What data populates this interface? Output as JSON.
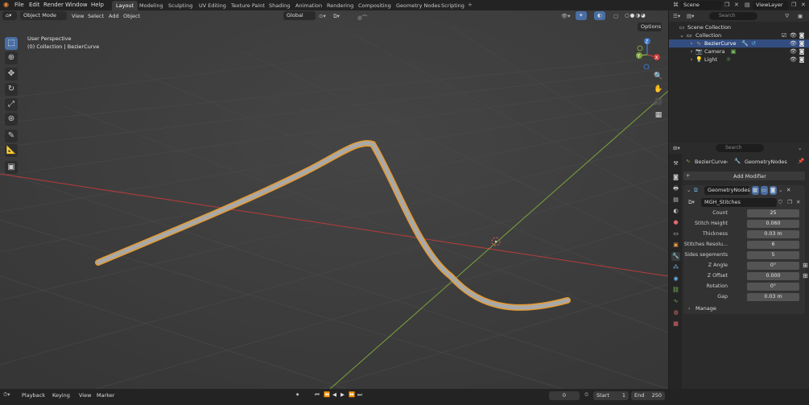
{
  "menubar": {
    "items": [
      "File",
      "Edit",
      "Render",
      "Window",
      "Help"
    ],
    "workspace_tabs": [
      "Layout",
      "Modeling",
      "Sculpting",
      "UV Editing",
      "Texture Paint",
      "Shading",
      "Animation",
      "Rendering",
      "Compositing",
      "Geometry Nodes",
      "Scripting"
    ],
    "active_tab": "Layout",
    "add_tab": "+",
    "scene_name": "Scene",
    "view_layer": "ViewLayer"
  },
  "viewport_header": {
    "mode": "Object Mode",
    "menus": [
      "View",
      "Select",
      "Add",
      "Object"
    ],
    "orientation": "Global",
    "options": "Options"
  },
  "viewport_overlay": {
    "perspective": "User Perspective",
    "collection_info": "(0) Collection | BezierCurve"
  },
  "gizmo": {
    "z": "Z",
    "y": "Y",
    "x": "X"
  },
  "outliner": {
    "search_placeholder": "Search",
    "scene_collection": "Scene Collection",
    "collection": "Collection",
    "items": [
      {
        "name": "BezierCurve",
        "selected": true
      },
      {
        "name": "Camera",
        "selected": false
      },
      {
        "name": "Light",
        "selected": false
      }
    ]
  },
  "properties": {
    "search_placeholder": "Search",
    "breadcrumb_object": "BezierCurve",
    "breadcrumb_modifier": "GeometryNodes",
    "add_modifier": "Add Modifier",
    "modifier_name": "GeometryNodes",
    "node_group": "MGH_Stitches",
    "fields": [
      {
        "label": "Count",
        "value": "25"
      },
      {
        "label": "Stitch Height",
        "value": "0.060"
      },
      {
        "label": "Thickness",
        "value": "0.03 m"
      },
      {
        "label": "Stitches Resolu...",
        "value": "6"
      },
      {
        "label": "Sides segements",
        "value": "5"
      },
      {
        "label": "Z Angle",
        "value": "0°"
      },
      {
        "label": "Z Offset",
        "value": "0.000"
      },
      {
        "label": "Rotation",
        "value": "0°"
      },
      {
        "label": "Gap",
        "value": "0.03 m"
      }
    ],
    "manage": "Manage"
  },
  "timeline": {
    "menus": [
      "Playback",
      "Keying",
      "View",
      "Marker"
    ],
    "current_frame": "0",
    "start_label": "Start",
    "start": "1",
    "end_label": "End",
    "end": "250"
  },
  "colors": {
    "viewport_bg": "#3d3d3d",
    "selection": "#f0a030",
    "accent_blue": "#4a6fa5",
    "x_axis": "#b83b3b",
    "y_axis": "#7ba23c"
  }
}
